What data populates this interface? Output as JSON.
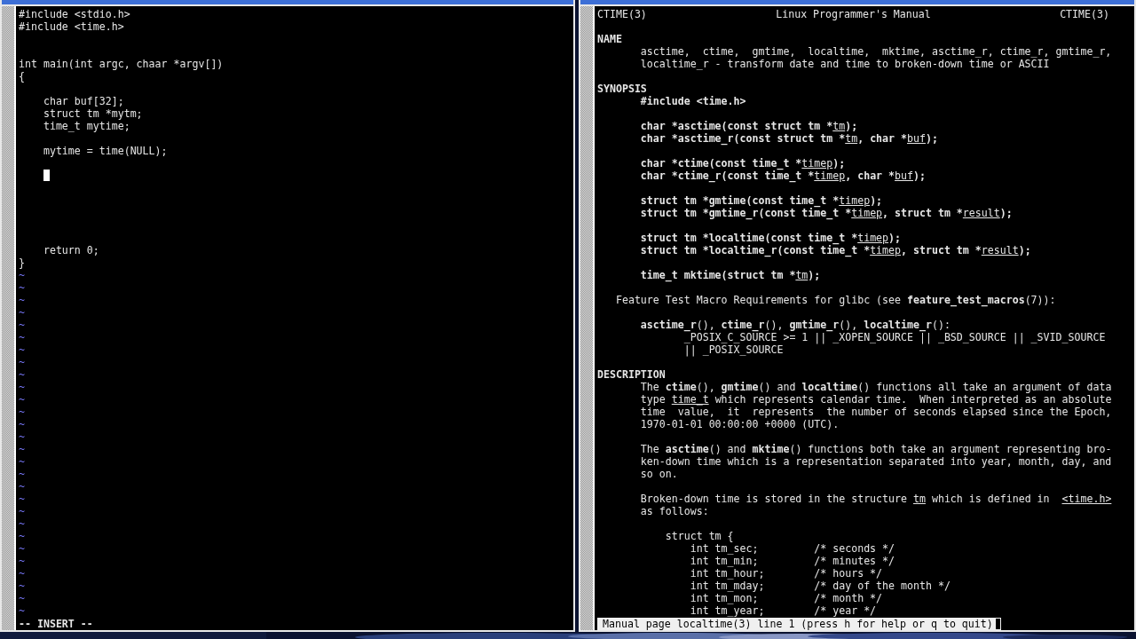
{
  "editor": {
    "lines": [
      {
        "kind": "code",
        "text": "#include <stdio.h>"
      },
      {
        "kind": "code",
        "text": "#include <time.h>"
      },
      {
        "kind": "blank"
      },
      {
        "kind": "blank"
      },
      {
        "kind": "code",
        "text": "int main(int argc, chaar *argv[])"
      },
      {
        "kind": "code",
        "text": "{"
      },
      {
        "kind": "blank"
      },
      {
        "kind": "code",
        "text": "    char buf[32];"
      },
      {
        "kind": "code",
        "text": "    struct tm *mytm;"
      },
      {
        "kind": "code",
        "text": "    time_t mytime;"
      },
      {
        "kind": "blank"
      },
      {
        "kind": "code",
        "text": "    mytime = time(NULL);"
      },
      {
        "kind": "blank"
      },
      {
        "kind": "cursor"
      },
      {
        "kind": "blank"
      },
      {
        "kind": "blank"
      },
      {
        "kind": "blank"
      },
      {
        "kind": "blank"
      },
      {
        "kind": "blank"
      },
      {
        "kind": "code",
        "text": "    return 0;"
      },
      {
        "kind": "code",
        "text": "}"
      },
      {
        "kind": "tilde",
        "text": "~"
      },
      {
        "kind": "tilde",
        "text": "~"
      },
      {
        "kind": "tilde",
        "text": "~"
      },
      {
        "kind": "tilde",
        "text": "~"
      },
      {
        "kind": "tilde",
        "text": "~"
      },
      {
        "kind": "tilde",
        "text": "~"
      },
      {
        "kind": "tilde",
        "text": "~"
      },
      {
        "kind": "tilde",
        "text": "~"
      },
      {
        "kind": "tilde",
        "text": "~"
      },
      {
        "kind": "tilde",
        "text": "~"
      },
      {
        "kind": "tilde",
        "text": "~"
      },
      {
        "kind": "tilde",
        "text": "~"
      },
      {
        "kind": "tilde",
        "text": "~"
      },
      {
        "kind": "tilde",
        "text": "~"
      },
      {
        "kind": "tilde",
        "text": "~"
      },
      {
        "kind": "tilde",
        "text": "~"
      },
      {
        "kind": "tilde",
        "text": "~"
      },
      {
        "kind": "tilde",
        "text": "~"
      },
      {
        "kind": "tilde",
        "text": "~"
      },
      {
        "kind": "tilde",
        "text": "~"
      },
      {
        "kind": "tilde",
        "text": "~"
      },
      {
        "kind": "tilde",
        "text": "~"
      },
      {
        "kind": "tilde",
        "text": "~"
      },
      {
        "kind": "tilde",
        "text": "~"
      },
      {
        "kind": "tilde",
        "text": "~"
      },
      {
        "kind": "tilde",
        "text": "~"
      },
      {
        "kind": "tilde",
        "text": "~"
      },
      {
        "kind": "tilde",
        "text": "~"
      }
    ],
    "mode": "-- INSERT --"
  },
  "manual": {
    "header": {
      "left": "CTIME(3)",
      "center": "Linux Programmer's Manual",
      "right": "CTIME(3)"
    },
    "lines": [
      {
        "kind": "blank"
      },
      {
        "kind": "heading",
        "text": "NAME"
      },
      {
        "kind": "text",
        "text": "       asctime,  ctime,  gmtime,  localtime,  mktime, asctime_r, ctime_r, gmtime_r,"
      },
      {
        "kind": "text",
        "text": "       localtime_r - transform date and time to broken-down time or ASCII"
      },
      {
        "kind": "blank"
      },
      {
        "kind": "heading",
        "text": "SYNOPSIS"
      },
      {
        "kind": "strong",
        "text": "       #include <time.h>"
      },
      {
        "kind": "blank"
      },
      {
        "kind": "text",
        "parts": [
          {
            "kind": "bold",
            "text": "       char *asctime(const struct tm *"
          },
          {
            "kind": "underline",
            "text": "tm"
          },
          {
            "kind": "bold",
            "text": ");"
          }
        ]
      },
      {
        "kind": "text",
        "parts": [
          {
            "kind": "bold",
            "text": "       char *asctime_r(const struct tm *"
          },
          {
            "kind": "underline",
            "text": "tm"
          },
          {
            "kind": "bold",
            "text": ", char *"
          },
          {
            "kind": "underline",
            "text": "buf"
          },
          {
            "kind": "bold",
            "text": ");"
          }
        ]
      },
      {
        "kind": "blank"
      },
      {
        "kind": "text",
        "parts": [
          {
            "kind": "bold",
            "text": "       char *ctime(const time_t *"
          },
          {
            "kind": "underline",
            "text": "timep"
          },
          {
            "kind": "bold",
            "text": ");"
          }
        ]
      },
      {
        "kind": "text",
        "parts": [
          {
            "kind": "bold",
            "text": "       char *ctime_r(const time_t *"
          },
          {
            "kind": "underline",
            "text": "timep"
          },
          {
            "kind": "bold",
            "text": ", char *"
          },
          {
            "kind": "underline",
            "text": "buf"
          },
          {
            "kind": "bold",
            "text": ");"
          }
        ]
      },
      {
        "kind": "blank"
      },
      {
        "kind": "text",
        "parts": [
          {
            "kind": "bold",
            "text": "       struct tm *gmtime(const time_t *"
          },
          {
            "kind": "underline",
            "text": "timep"
          },
          {
            "kind": "bold",
            "text": ");"
          }
        ]
      },
      {
        "kind": "text",
        "parts": [
          {
            "kind": "bold",
            "text": "       struct tm *gmtime_r(const time_t *"
          },
          {
            "kind": "underline",
            "text": "timep"
          },
          {
            "kind": "bold",
            "text": ", struct tm *"
          },
          {
            "kind": "underline",
            "text": "result"
          },
          {
            "kind": "bold",
            "text": ");"
          }
        ]
      },
      {
        "kind": "blank"
      },
      {
        "kind": "text",
        "parts": [
          {
            "kind": "bold",
            "text": "       struct tm *localtime(const time_t *"
          },
          {
            "kind": "underline",
            "text": "timep"
          },
          {
            "kind": "bold",
            "text": ");"
          }
        ]
      },
      {
        "kind": "text",
        "parts": [
          {
            "kind": "bold",
            "text": "       struct tm *localtime_r(const time_t *"
          },
          {
            "kind": "underline",
            "text": "timep"
          },
          {
            "kind": "bold",
            "text": ", struct tm *"
          },
          {
            "kind": "underline",
            "text": "result"
          },
          {
            "kind": "bold",
            "text": ");"
          }
        ]
      },
      {
        "kind": "blank"
      },
      {
        "kind": "text",
        "parts": [
          {
            "kind": "bold",
            "text": "       time_t mktime(struct tm *"
          },
          {
            "kind": "underline",
            "text": "tm"
          },
          {
            "kind": "bold",
            "text": ");"
          }
        ]
      },
      {
        "kind": "blank"
      },
      {
        "kind": "text",
        "parts": [
          {
            "kind": "plain",
            "text": "   Feature Test Macro Requirements for glibc (see "
          },
          {
            "kind": "bold",
            "text": "feature_test_macros"
          },
          {
            "kind": "plain",
            "text": "(7)):"
          }
        ]
      },
      {
        "kind": "blank"
      },
      {
        "kind": "text",
        "parts": [
          {
            "kind": "bold",
            "text": "       asctime_r"
          },
          {
            "kind": "plain",
            "text": "(), "
          },
          {
            "kind": "bold",
            "text": "ctime_r"
          },
          {
            "kind": "plain",
            "text": "(), "
          },
          {
            "kind": "bold",
            "text": "gmtime_r"
          },
          {
            "kind": "plain",
            "text": "(), "
          },
          {
            "kind": "bold",
            "text": "localtime_r"
          },
          {
            "kind": "plain",
            "text": "():"
          }
        ]
      },
      {
        "kind": "text",
        "text": "              _POSIX_C_SOURCE >= 1 || _XOPEN_SOURCE || _BSD_SOURCE || _SVID_SOURCE"
      },
      {
        "kind": "text",
        "text": "              || _POSIX_SOURCE"
      },
      {
        "kind": "blank"
      },
      {
        "kind": "heading",
        "text": "DESCRIPTION"
      },
      {
        "kind": "text",
        "parts": [
          {
            "kind": "plain",
            "text": "       The "
          },
          {
            "kind": "bold",
            "text": "ctime"
          },
          {
            "kind": "plain",
            "text": "(), "
          },
          {
            "kind": "bold",
            "text": "gmtime"
          },
          {
            "kind": "plain",
            "text": "() and "
          },
          {
            "kind": "bold",
            "text": "localtime"
          },
          {
            "kind": "plain",
            "text": "() functions all take an argument of data"
          }
        ]
      },
      {
        "kind": "text",
        "parts": [
          {
            "kind": "plain",
            "text": "       type "
          },
          {
            "kind": "underline",
            "text": "time_t"
          },
          {
            "kind": "plain",
            "text": " which represents calendar time.  When interpreted as an absolute"
          }
        ]
      },
      {
        "kind": "text",
        "text": "       time  value,  it  represents  the number of seconds elapsed since the Epoch,"
      },
      {
        "kind": "text",
        "text": "       1970-01-01 00:00:00 +0000 (UTC)."
      },
      {
        "kind": "blank"
      },
      {
        "kind": "text",
        "parts": [
          {
            "kind": "plain",
            "text": "       The "
          },
          {
            "kind": "bold",
            "text": "asctime"
          },
          {
            "kind": "plain",
            "text": "() and "
          },
          {
            "kind": "bold",
            "text": "mktime"
          },
          {
            "kind": "plain",
            "text": "() functions both take an argument representing bro-"
          }
        ]
      },
      {
        "kind": "text",
        "text": "       ken-down time which is a representation separated into year, month, day, and"
      },
      {
        "kind": "text",
        "text": "       so on."
      },
      {
        "kind": "blank"
      },
      {
        "kind": "text",
        "parts": [
          {
            "kind": "plain",
            "text": "       Broken-down time is stored in the structure "
          },
          {
            "kind": "underline",
            "text": "tm"
          },
          {
            "kind": "plain",
            "text": " which is defined in  "
          },
          {
            "kind": "underline",
            "text": "<time.h>"
          }
        ]
      },
      {
        "kind": "text",
        "text": "       as follows:"
      },
      {
        "kind": "blank"
      },
      {
        "kind": "text",
        "text": "           struct tm {"
      },
      {
        "kind": "text",
        "text": "               int tm_sec;         /* seconds */"
      },
      {
        "kind": "text",
        "text": "               int tm_min;         /* minutes */"
      },
      {
        "kind": "text",
        "text": "               int tm_hour;        /* hours */"
      },
      {
        "kind": "text",
        "text": "               int tm_mday;        /* day of the month */"
      },
      {
        "kind": "text",
        "text": "               int tm_mon;         /* month */"
      },
      {
        "kind": "text",
        "text": "               int tm_year;        /* year */"
      }
    ],
    "status": "Manual page localtime(3) line 1 (press h for help or q to quit)"
  }
}
